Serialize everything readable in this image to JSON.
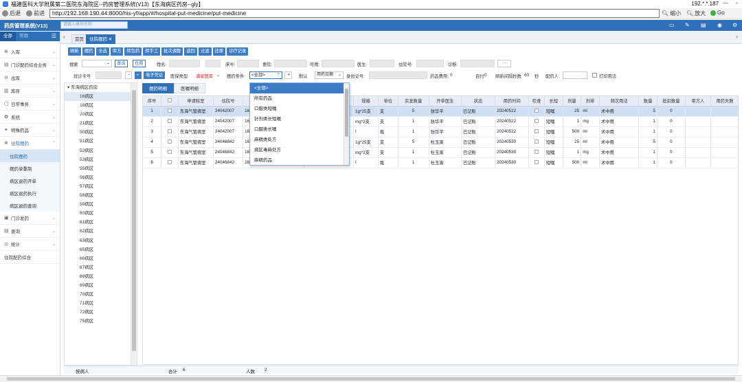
{
  "window": {
    "title": "福建医科大学附属第二医院东海院区--药房管理系统(V13)【东海病区药房--gly】",
    "ip": "192.*.*.187",
    "controls": [
      "—",
      "▫"
    ]
  },
  "nav": {
    "back": "后退",
    "forward": "前进",
    "url": "http://192.168.190.44:8000/his-yf/app/#/hospital-put-medicine/put-medicine",
    "zoom_out": "缩小",
    "zoom_in": "放大",
    "go": "Go"
  },
  "header": {
    "system": "药房管理系统(V13)",
    "search_placeholder": "请输入模块名称",
    "icons": [
      "monitor-icon",
      "pin-icon",
      "document-icon",
      "eye-icon",
      "gear-icon"
    ]
  },
  "sidebar": {
    "tabs": [
      "全部",
      "常用"
    ],
    "items": [
      {
        "icon": "⊕",
        "label": "入库"
      },
      {
        "icon": "▤",
        "label": "门诊配药综合业务"
      },
      {
        "icon": "⊖",
        "label": "出库"
      },
      {
        "icon": "▥",
        "label": "库存"
      },
      {
        "icon": "▢",
        "label": "日常事务"
      },
      {
        "icon": "✿",
        "label": "系统"
      },
      {
        "icon": "✦",
        "label": "特殊药品"
      },
      {
        "icon": "⊗",
        "label": "住院摆药"
      }
    ],
    "subitems": [
      "住院摆药",
      "摆药单重制",
      "病区退药开单",
      "病区退药执行",
      "病区退药查询"
    ],
    "items2": [
      {
        "icon": "▣",
        "label": "门诊发药"
      },
      {
        "icon": "▤",
        "label": "查询"
      },
      {
        "icon": "◎",
        "label": "统计"
      },
      {
        "icon": "",
        "label": "住院配药综合"
      }
    ]
  },
  "tabs": {
    "home": "首页",
    "current": "住院摆药 ✕"
  },
  "toolbar": [
    "刷新",
    "摆药",
    "全选",
    "审方",
    "转包药",
    "转手工",
    "批次调整",
    "返回",
    "过滤",
    "还原",
    "诊疗记录"
  ],
  "filters": {
    "search_label": "搜索",
    "query": "查询",
    "reset": "任用",
    "name": "姓名:",
    "bed": "床号:",
    "ward": "要院:",
    "available": "可用:",
    "doctor": "医生:",
    "inpatient_no": "住院号:",
    "diagnosis": "诊断:",
    "ellipsis": "···",
    "card_label": "就诊卡号",
    "e_voucher": "电子凭证",
    "insurance_type": "医保类型:",
    "insurance_value": "满家医库",
    "dispense_cond": "摆药条件:",
    "dispense_value": "<全部>",
    "collapse": "«",
    "default": "默认",
    "date_type": "用药日期",
    "id_card": "身份证号:",
    "drug_fee": "药品费用:",
    "drug_fee_val": "0",
    "self_pay": "自付:",
    "self_pay_val": "0",
    "refresh_interval": "刷新间隔秒数",
    "refresh_val": "60",
    "sec": "秒",
    "pharmacist": "配药人:",
    "print_usage": "打印用法"
  },
  "ward_tree": {
    "root": "东海病区药房",
    "nodes": [
      "16病区",
      "18病区",
      "20病区",
      "21病区",
      "50病区",
      "51病区",
      "52病区",
      "53病区",
      "55病区",
      "56病区",
      "57病区",
      "58病区",
      "59病区",
      "60病区",
      "61病区",
      "62病区",
      "63病区",
      "65病区",
      "66病区",
      "67病区",
      "68病区",
      "69病区",
      "70病区",
      "71病区",
      "72病区",
      "75病区"
    ]
  },
  "subtabs": [
    "摆药明细",
    "医嘱明细"
  ],
  "grid": {
    "columns": [
      "序号",
      "",
      "申请科室",
      "住院号",
      "",
      "",
      "",
      "规格",
      "单位",
      "实发数量",
      "开单医生",
      "状态",
      "用药时间",
      "检查",
      "长短",
      "剂量",
      "剂单",
      "频次用法",
      "数量",
      "抵扣数量",
      "审方人",
      "用药天数"
    ],
    "rows": [
      [
        "1",
        "",
        "东海气管病室",
        "24042007",
        "16",
        "",
        "",
        "1g*25支",
        "支",
        "5",
        "张华平",
        "已记账",
        "20240522",
        "",
        "短嘱",
        "25",
        "ml",
        "术中用",
        "5",
        "0",
        "",
        ""
      ],
      [
        "2",
        "",
        "东海气管病室",
        "24042007",
        "16",
        "",
        "",
        "mg*2支",
        "支",
        "1",
        "张华平",
        "已记账",
        "20240522",
        "",
        "短嘱",
        "1",
        "mg",
        "术中用",
        "1",
        "0",
        "",
        ""
      ],
      [
        "3",
        "",
        "东海气管病室",
        "24042007",
        "16",
        "",
        "",
        "I",
        "瓶",
        "1",
        "张华平",
        "已记账",
        "20240522",
        "",
        "短嘱",
        "500",
        "ml",
        "术中用",
        "1",
        "0",
        "",
        ""
      ],
      [
        "4",
        "",
        "东海气管病室",
        "24046842",
        "16",
        "",
        "",
        "1g*25支",
        "支",
        "5",
        "杜玉寅",
        "已记账",
        "20240530",
        "",
        "短嘱",
        "25",
        "ml",
        "术中用",
        "5",
        "0",
        "",
        ""
      ],
      [
        "5",
        "",
        "东海气管病室",
        "24046842",
        "16",
        "",
        "",
        "mg*2支",
        "支",
        "1",
        "杜玉寅",
        "已记账",
        "20240530",
        "",
        "短嘱",
        "1",
        "mg",
        "术中用",
        "1",
        "0",
        "",
        ""
      ],
      [
        "6",
        "",
        "东海气管病室",
        "24046842",
        "16",
        "",
        "",
        "I",
        "瓶",
        "1",
        "杜玉寅",
        "已记账",
        "20240530",
        "",
        "短嘱",
        "500",
        "ml",
        "术中用",
        "1",
        "0",
        "",
        ""
      ]
    ]
  },
  "dropdown": {
    "options": [
      "<全部>",
      "所有药品",
      "口服类短嘱",
      "针剂类长短嘱",
      "口服类长嘱",
      "麻精类处方",
      "病区毒麻处方",
      "麻精药品"
    ]
  },
  "footer": {
    "patient_label": "按病人",
    "total_label": "合计",
    "total_val": "6",
    "persons_label": "人数",
    "persons_val": "2"
  },
  "colors": {
    "primary": "#2f70b8",
    "button": "#3c7cc4",
    "row_selected": "#cfe0f5",
    "alert": "#d02020"
  }
}
